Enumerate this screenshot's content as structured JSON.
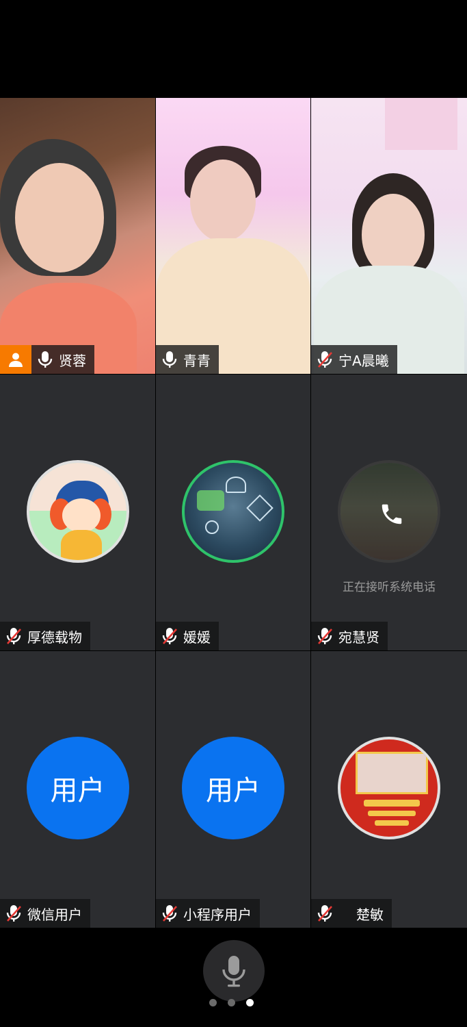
{
  "participants": [
    {
      "name": "贤蓉",
      "type": "video",
      "host": true,
      "mic": "on"
    },
    {
      "name": "青青",
      "type": "video",
      "host": false,
      "mic": "on"
    },
    {
      "name": "宁A晨曦",
      "type": "video",
      "host": false,
      "mic": "muted"
    },
    {
      "name": "厚德载物",
      "type": "avatar",
      "mic": "muted"
    },
    {
      "name": "媛媛",
      "type": "avatar",
      "mic": "muted"
    },
    {
      "name": "宛慧贤",
      "type": "avatar-call",
      "mic": "muted",
      "status": "正在接听系统电话"
    },
    {
      "name": "微信用户",
      "type": "avatar-text",
      "avatar_text": "用户",
      "mic": "muted"
    },
    {
      "name": "小程序用户",
      "type": "avatar-text",
      "avatar_text": "用户",
      "mic": "muted"
    },
    {
      "name": "楚敏",
      "type": "avatar",
      "mic": "muted"
    }
  ],
  "icons": {
    "host": "person-icon",
    "mic_on": "microphone-icon",
    "mic_muted": "microphone-muted-icon",
    "phone": "phone-icon"
  },
  "colors": {
    "host_badge": "#f77a00",
    "avatar_blue": "#0a73f0",
    "active_speaker": "#2fbf4a",
    "muted_red": "#e53935"
  },
  "pagination": {
    "total": 3,
    "current": 3
  }
}
